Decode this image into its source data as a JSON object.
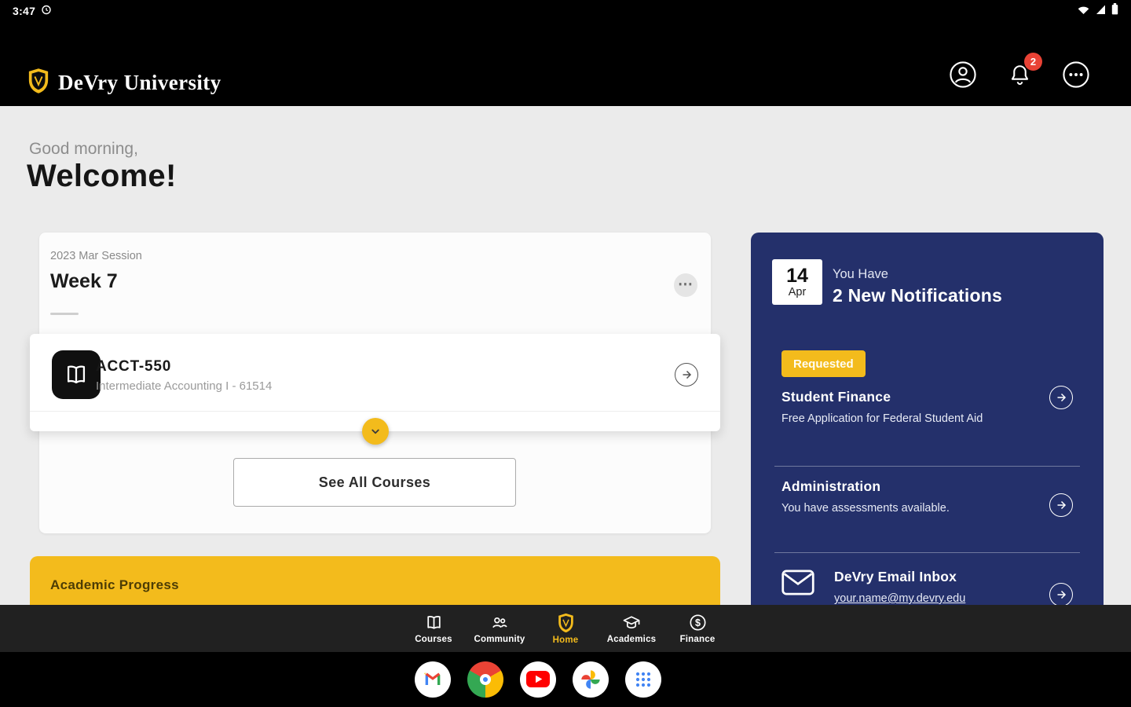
{
  "colors": {
    "gold": "#F3BB1C",
    "navy": "#24306B",
    "badge-red": "#E94235",
    "nav-bar": "#212121",
    "bg": "#EBEBEB"
  },
  "status_bar": {
    "time": "3:47"
  },
  "header": {
    "brand": "DeVry University",
    "notification_badge": "2"
  },
  "greeting": {
    "small": "Good morning,",
    "big": "Welcome!"
  },
  "session": {
    "label": "2023 Mar Session",
    "week": "Week 7",
    "menu": "⋯",
    "course": {
      "code": "ACCT-550",
      "subtitle": "Intermediate Accounting I - 61514"
    },
    "see_all": "See All Courses"
  },
  "banner": {
    "title": "Academic Progress"
  },
  "panel": {
    "date": {
      "day": "14",
      "month": "Apr"
    },
    "intro": "You Have",
    "title": "2 New Notifications",
    "badge": "Requested",
    "items": [
      {
        "title": "Student Finance",
        "subtitle": "Free Application for Federal Student Aid"
      },
      {
        "title": "Administration",
        "subtitle": "You have assessments available."
      },
      {
        "title": "DeVry Email Inbox",
        "subtitle": "your.name@my.devry.edu"
      }
    ]
  },
  "bottom_nav": {
    "items": [
      {
        "label": "Courses"
      },
      {
        "label": "Community"
      },
      {
        "label": "Home"
      },
      {
        "label": "Academics"
      },
      {
        "label": "Finance"
      }
    ]
  }
}
